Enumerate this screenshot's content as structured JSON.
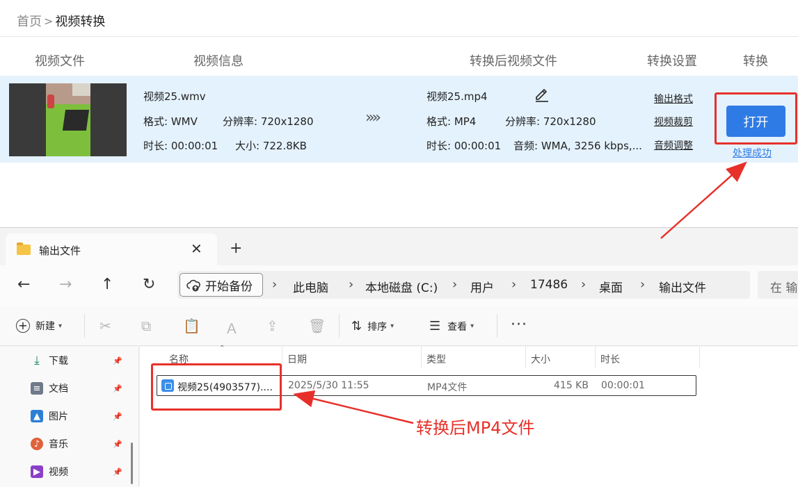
{
  "breadcrumb": {
    "home": "首页",
    "separator": ">",
    "current": "视频转换"
  },
  "columns": {
    "video_file": "视频文件",
    "video_info": "视频信息",
    "converted_file": "转换后视频文件",
    "settings": "转换设置",
    "convert": "转换"
  },
  "source": {
    "filename": "视频25.wmv",
    "format": "格式: WMV",
    "resolution": "分辨率: 720x1280",
    "duration": "时长: 00:00:01",
    "size": "大小: 722.8KB"
  },
  "arrows": "»»",
  "output": {
    "filename": "视频25.mp4",
    "format": "格式: MP4",
    "resolution": "分辨率: 720x1280",
    "duration": "时长: 00:00:01",
    "audio": "音频: WMA, 3256 kbps,..."
  },
  "settings_links": [
    "输出格式",
    "视频裁剪",
    "音频调整"
  ],
  "open_button": "打开",
  "status": "处理成功",
  "explorer": {
    "tab_title": "输出文件",
    "tab_close": "✕",
    "new_tab": "+",
    "backup_label": "开始备份",
    "path": [
      "此电脑",
      "本地磁盘 (C:)",
      "用户",
      "17486",
      "桌面",
      "输出文件"
    ],
    "path_separator": "›",
    "search_placeholder": "在 输",
    "toolbar": {
      "new_label": "新建",
      "sort_label": "排序",
      "view_label": "查看",
      "more": "···"
    },
    "sidebar": [
      {
        "label": "下载",
        "icon": "download-icon"
      },
      {
        "label": "文档",
        "icon": "document-icon"
      },
      {
        "label": "图片",
        "icon": "pictures-icon"
      },
      {
        "label": "音乐",
        "icon": "music-icon"
      },
      {
        "label": "视频",
        "icon": "videos-icon"
      }
    ],
    "file_columns": {
      "name": "名称",
      "date": "日期",
      "type": "类型",
      "size": "大小",
      "duration": "时长"
    },
    "file": {
      "name": "视频25(4903577)....",
      "date": "2025/5/30 11:55",
      "type": "MP4文件",
      "size": "415 KB",
      "duration": "00:00:01"
    }
  },
  "annotation": {
    "text": "转换后MP4文件",
    "color": "#e8302a"
  },
  "colors": {
    "accent": "#2f7be5",
    "row_highlight": "#e4f2fd",
    "annotation": "#e8302a"
  }
}
